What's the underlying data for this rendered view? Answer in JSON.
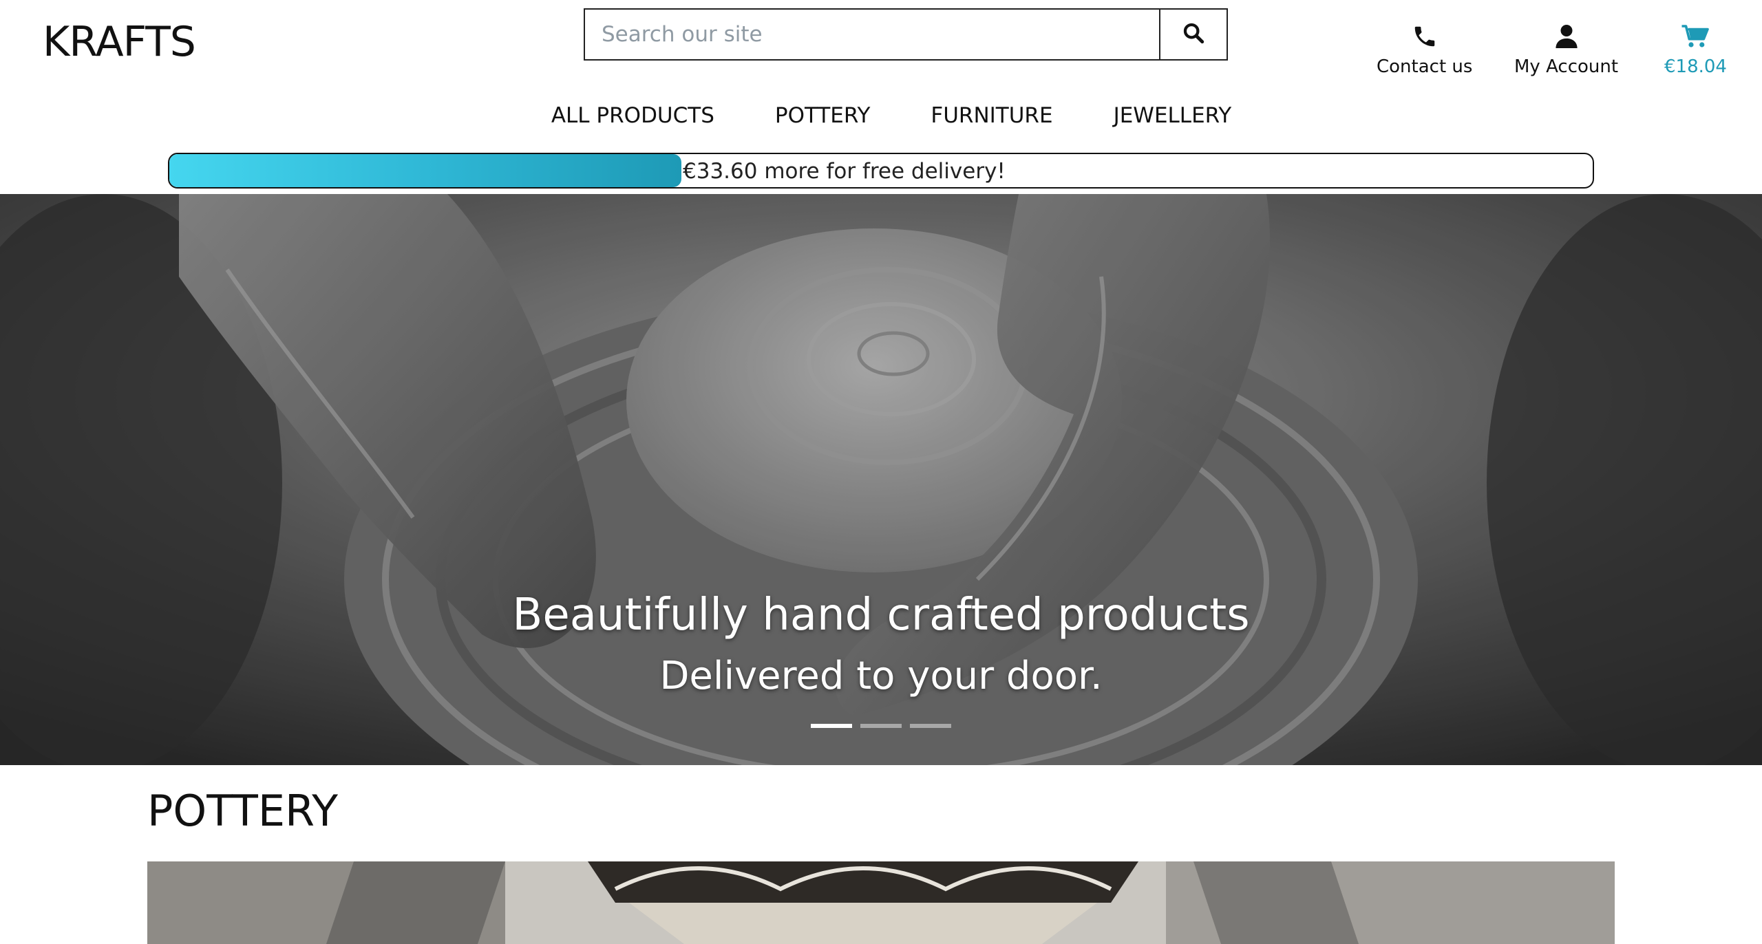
{
  "brand": {
    "logo": "KRAFTS"
  },
  "colors": {
    "accent": "#1e9ab6",
    "progress_start": "#45d6ef",
    "progress_end": "#1e9ab6",
    "text": "#111111"
  },
  "search": {
    "placeholder": "Search our site",
    "value": "",
    "icon": "search-icon"
  },
  "header": {
    "contact": {
      "label": "Contact us",
      "icon": "phone-icon"
    },
    "account": {
      "label": "My Account",
      "icon": "user-icon"
    },
    "cart": {
      "label": "€18.04",
      "icon": "cart-icon"
    }
  },
  "nav": {
    "items": [
      "ALL PRODUCTS",
      "POTTERY",
      "FURNITURE",
      "JEWELLERY"
    ]
  },
  "delivery": {
    "message": "€33.60 more for free delivery!",
    "progress": 0.36
  },
  "hero": {
    "headline": "Beautifully hand crafted products",
    "subline": "Delivered to your door.",
    "slides": 3,
    "active_slide": 0
  },
  "section": {
    "title": "POTTERY"
  }
}
